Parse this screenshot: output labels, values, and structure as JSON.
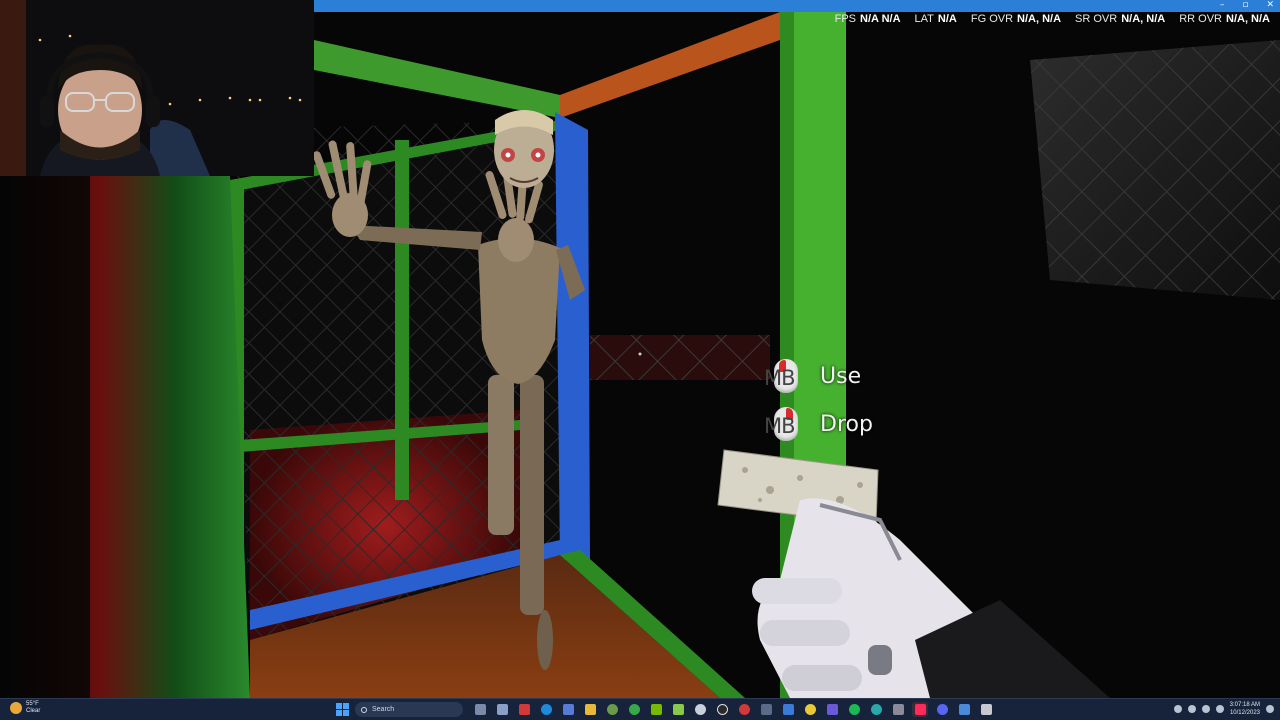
{
  "window_controls": {
    "minimize": "–",
    "maximize": "▫",
    "close": "✕"
  },
  "perf_overlay": [
    {
      "label": "FPS",
      "value": "N/A N/A"
    },
    {
      "label": "LAT",
      "value": "N/A"
    },
    {
      "label": "FG OVR",
      "value": "N/A, N/A"
    },
    {
      "label": "SR OVR",
      "value": "N/A, N/A"
    },
    {
      "label": "RR OVR",
      "value": "N/A, N/A"
    }
  ],
  "prompts": [
    {
      "key": "MB",
      "action": "Use",
      "button": "left"
    },
    {
      "key": "MB",
      "action": "Drop",
      "button": "right"
    }
  ],
  "taskbar": {
    "weather": {
      "temp": "55°F",
      "condition": "Clear"
    },
    "search_placeholder": "Search",
    "icons": [
      "chat-icon",
      "file-explorer-icon",
      "red-app-icon",
      "edge-icon",
      "blue-app-icon",
      "folder-icon",
      "xbox-icon",
      "green-app-icon",
      "nvidia-icon",
      "green-app-2-icon",
      "steam-icon",
      "obs-icon",
      "camera-icon",
      "tools-icon",
      "store-icon",
      "chrome-icon",
      "teams-icon",
      "spotify-icon",
      "edge-dev-icon",
      "calculator-icon",
      "tiktok-icon",
      "discord-icon",
      "pen-icon",
      "vr-icon"
    ],
    "clock_time": "3:07:18 AM",
    "clock_date": "10/12/2023"
  },
  "colors": {
    "accent": "#2b7fd6",
    "pillar_green": "#3fae2c",
    "cage_blue": "#2a5fd0",
    "cage_orange": "#c2581f",
    "prompt_red": "#d92b2b"
  }
}
